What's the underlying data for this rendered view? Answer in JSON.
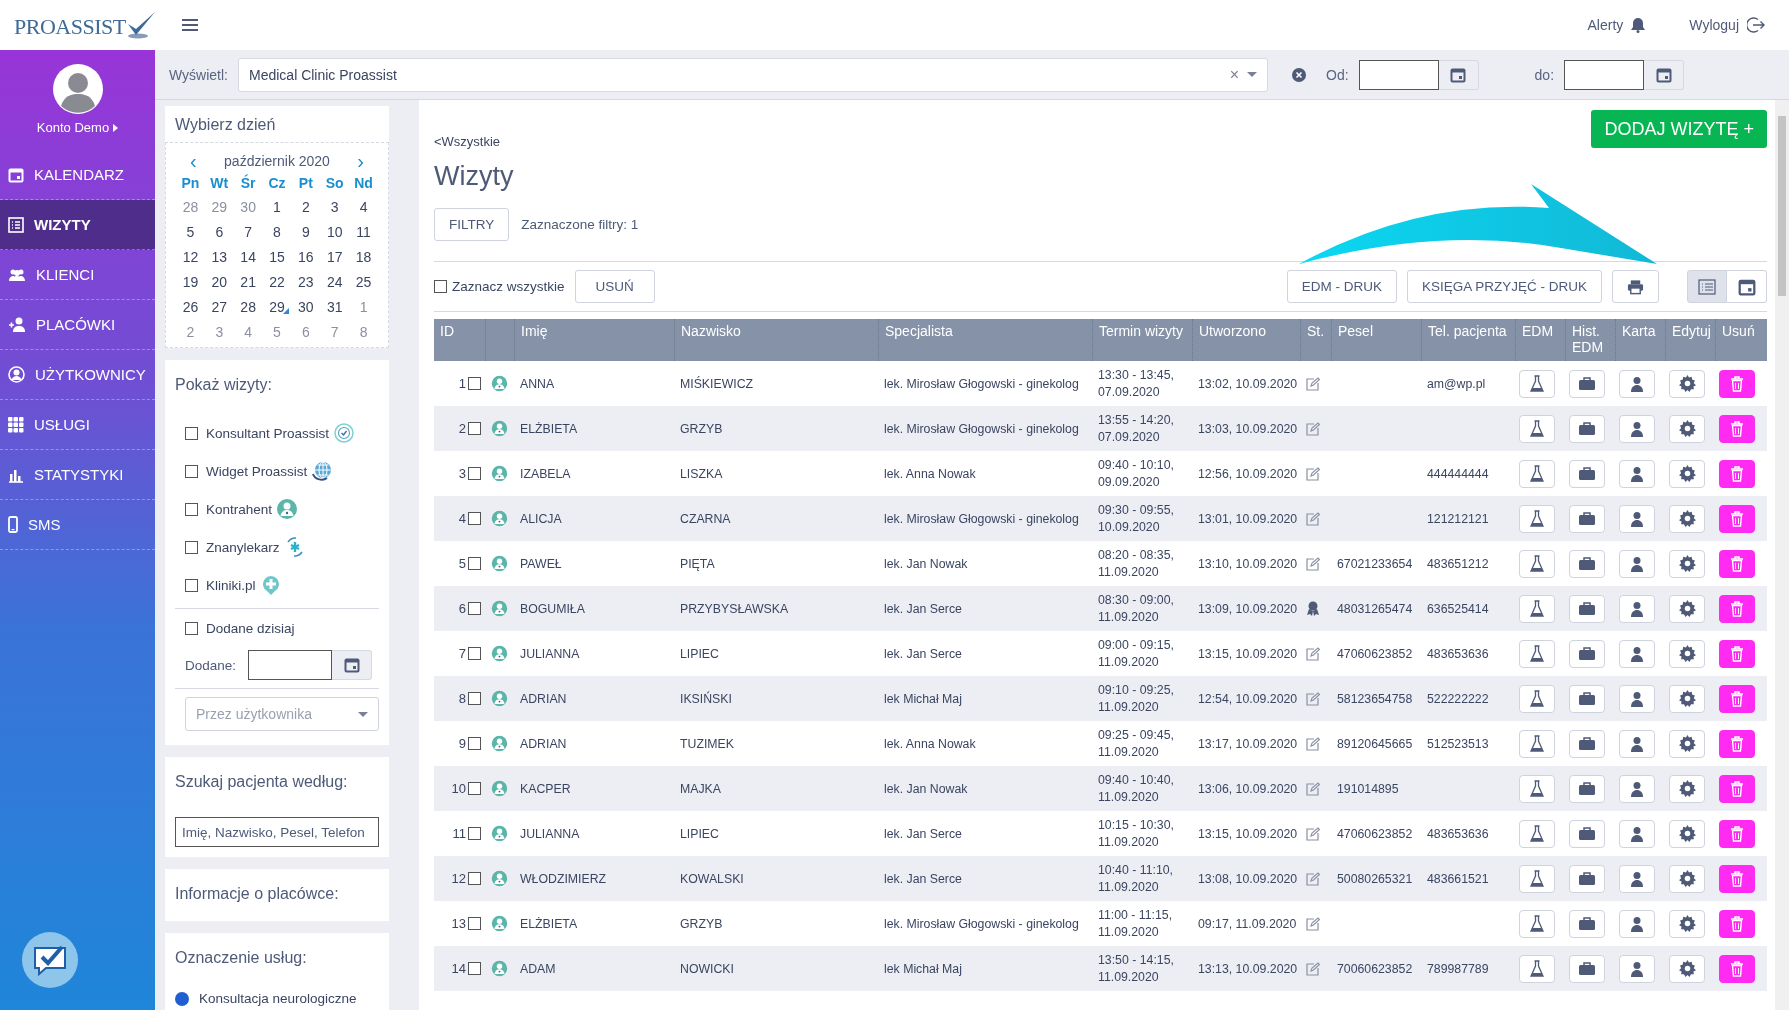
{
  "header": {
    "logo": "PROASSIST",
    "alerts": "Alerty",
    "logout": "Wyloguj"
  },
  "sidebar": {
    "user": "Konto Demo",
    "items": [
      {
        "label": "KALENDARZ",
        "kind": "calendar",
        "selected": false
      },
      {
        "label": "WIZYTY",
        "kind": "list",
        "selected": true
      },
      {
        "label": "KLIENCI",
        "kind": "group",
        "selected": false
      },
      {
        "label": "PLACÓWKI",
        "kind": "user-plus",
        "selected": false
      },
      {
        "label": "UŻYTKOWNICY",
        "kind": "user-circle",
        "selected": false
      },
      {
        "label": "USŁUGI",
        "kind": "grid",
        "selected": false
      },
      {
        "label": "STATYSTYKI",
        "kind": "bars",
        "selected": false
      },
      {
        "label": "SMS",
        "kind": "phone",
        "selected": false
      }
    ]
  },
  "filter_bar": {
    "display_label": "Wyświetl:",
    "display_value": "Medical Clinic Proassist",
    "clear": "×",
    "from_label": "Od:",
    "to_label": "do:"
  },
  "calendar": {
    "title": "Wybierz dzień",
    "month": "październik 2020",
    "prev": "‹",
    "next": "›",
    "weekdays": [
      "Pn",
      "Wt",
      "Śr",
      "Cz",
      "Pt",
      "So",
      "Nd"
    ],
    "weeks": [
      [
        {
          "day": "28",
          "muted": true,
          "marked": false
        },
        {
          "day": "29",
          "muted": true,
          "marked": false
        },
        {
          "day": "30",
          "muted": true,
          "marked": false
        },
        {
          "day": "1",
          "muted": false,
          "marked": false
        },
        {
          "day": "2",
          "muted": false,
          "marked": false
        },
        {
          "day": "3",
          "muted": false,
          "marked": false
        },
        {
          "day": "4",
          "muted": false,
          "marked": false
        }
      ],
      [
        {
          "day": "5",
          "muted": false,
          "marked": false
        },
        {
          "day": "6",
          "muted": false,
          "marked": false
        },
        {
          "day": "7",
          "muted": false,
          "marked": false
        },
        {
          "day": "8",
          "muted": false,
          "marked": false
        },
        {
          "day": "9",
          "muted": false,
          "marked": false
        },
        {
          "day": "10",
          "muted": false,
          "marked": false
        },
        {
          "day": "11",
          "muted": false,
          "marked": false
        }
      ],
      [
        {
          "day": "12",
          "muted": false,
          "marked": false
        },
        {
          "day": "13",
          "muted": false,
          "marked": false
        },
        {
          "day": "14",
          "muted": false,
          "marked": false
        },
        {
          "day": "15",
          "muted": false,
          "marked": false
        },
        {
          "day": "16",
          "muted": false,
          "marked": false
        },
        {
          "day": "17",
          "muted": false,
          "marked": false
        },
        {
          "day": "18",
          "muted": false,
          "marked": false
        }
      ],
      [
        {
          "day": "19",
          "muted": false,
          "marked": false
        },
        {
          "day": "20",
          "muted": false,
          "marked": false
        },
        {
          "day": "21",
          "muted": false,
          "marked": false
        },
        {
          "day": "22",
          "muted": false,
          "marked": false
        },
        {
          "day": "23",
          "muted": false,
          "marked": false
        },
        {
          "day": "24",
          "muted": false,
          "marked": false
        },
        {
          "day": "25",
          "muted": false,
          "marked": false
        }
      ],
      [
        {
          "day": "26",
          "muted": false,
          "marked": false
        },
        {
          "day": "27",
          "muted": false,
          "marked": false
        },
        {
          "day": "28",
          "muted": false,
          "marked": false
        },
        {
          "day": "29",
          "muted": false,
          "marked": true
        },
        {
          "day": "30",
          "muted": false,
          "marked": false
        },
        {
          "day": "31",
          "muted": false,
          "marked": false
        },
        {
          "day": "1",
          "muted": true,
          "marked": false
        }
      ],
      [
        {
          "day": "2",
          "muted": true,
          "marked": false
        },
        {
          "day": "3",
          "muted": true,
          "marked": false
        },
        {
          "day": "4",
          "muted": true,
          "marked": false
        },
        {
          "day": "5",
          "muted": true,
          "marked": false
        },
        {
          "day": "6",
          "muted": true,
          "marked": false
        },
        {
          "day": "7",
          "muted": true,
          "marked": false
        },
        {
          "day": "8",
          "muted": true,
          "marked": false
        }
      ]
    ]
  },
  "show_visits": {
    "title": "Pokaż wizyty:",
    "sources": [
      {
        "label": "Konsultant Proassist",
        "kind": "headset",
        "checked": false
      },
      {
        "label": "Widget Proassist",
        "kind": "globe",
        "checked": false
      },
      {
        "label": "Kontrahent",
        "kind": "person",
        "checked": false
      },
      {
        "label": "Znanylekarz",
        "kind": "medic",
        "checked": false
      },
      {
        "label": "Kliniki.pl",
        "kind": "cross",
        "checked": false
      }
    ],
    "added_today": {
      "label": "Dodane dzisiaj",
      "checked": false
    },
    "added_label": "Dodane:",
    "user_placeholder": "Przez użytkownika"
  },
  "search": {
    "title": "Szukaj pacjenta według:",
    "placeholder": "Imię, Nazwisko, Pesel, Telefon"
  },
  "clinic_info": {
    "title": "Informacje o placówce:"
  },
  "services": {
    "title": "Oznaczenie usług:",
    "items": [
      {
        "label": "Konsultacja neurologiczne",
        "color": "#1f5fd1"
      }
    ]
  },
  "main": {
    "back_link": "<Wszystkie",
    "title": "Wizyty",
    "add_button": "DODAJ WIZYTĘ +",
    "filters_button": "FILTRY",
    "filters_count": "Zaznaczone filtry: 1",
    "select_all": {
      "label": "Zaznacz wszystkie",
      "checked": false
    },
    "delete_button": "USUŃ",
    "edm_print": "EDM - DRUK",
    "book_print": "KSIĘGA PRZYJĘĆ - DRUK",
    "views": [
      {
        "kind": "list",
        "selected": true
      },
      {
        "kind": "calendar",
        "selected": false
      }
    ]
  },
  "table": {
    "columns": [
      "ID",
      "",
      "Imię",
      "Nazwisko",
      "Specjalista",
      "Termin wizyty",
      "Utworzono",
      "St.",
      "Pesel",
      "Tel. pacjenta",
      "EDM",
      "Hist. EDM",
      "Karta",
      "Edytuj",
      "Usuń"
    ],
    "rows": [
      {
        "id": "1",
        "checked": false,
        "first": "ANNA",
        "last": "MIŚKIEWICZ",
        "specialist": "lek. Mirosław Głogowski - ginekolog",
        "time": "13:30 - 13:45,",
        "date": "07.09.2020",
        "created": "13:02, 10.09.2020",
        "kind": "edit",
        "phone": "am@wp.pl"
      },
      {
        "id": "2",
        "checked": false,
        "first": "ELŻBIETA",
        "last": "GRZYB",
        "specialist": "lek. Mirosław Głogowski - ginekolog",
        "time": "13:55 - 14:20,",
        "date": "07.09.2020",
        "created": "13:03, 10.09.2020",
        "kind": "edit"
      },
      {
        "id": "3",
        "checked": false,
        "first": "IZABELA",
        "last": "LISZKA",
        "specialist": "lek. Anna Nowak",
        "time": "09:40 - 10:10,",
        "date": "09.09.2020",
        "created": "12:56, 10.09.2020",
        "kind": "edit",
        "phone": "444444444"
      },
      {
        "id": "4",
        "checked": false,
        "first": "ALICJA",
        "last": "CZARNA",
        "specialist": "lek. Mirosław Głogowski - ginekolog",
        "time": "09:30 - 09:55,",
        "date": "10.09.2020",
        "created": "13:01, 10.09.2020",
        "kind": "edit",
        "phone": "121212121"
      },
      {
        "id": "5",
        "checked": false,
        "first": "PAWEŁ",
        "last": "PIĘTA",
        "specialist": "lek. Jan Nowak",
        "time": "08:20 - 08:35,",
        "date": "11.09.2020",
        "created": "13:10, 10.09.2020",
        "kind": "edit",
        "pesel": "67021233654",
        "phone": "483651212"
      },
      {
        "id": "6",
        "checked": false,
        "first": "BOGUMIŁA",
        "last": "PRZYBYSŁAWSKA",
        "specialist": "lek. Jan Serce",
        "time": "08:30 - 09:00,",
        "date": "11.09.2020",
        "created": "13:09, 10.09.2020",
        "kind": "award",
        "pesel": "48031265474",
        "phone": "636525414"
      },
      {
        "id": "7",
        "checked": false,
        "first": "JULIANNA",
        "last": "LIPIEC",
        "specialist": "lek. Jan Serce",
        "time": "09:00 - 09:15,",
        "date": "11.09.2020",
        "created": "13:15, 10.09.2020",
        "kind": "edit",
        "pesel": "47060623852",
        "phone": "483653636"
      },
      {
        "id": "8",
        "checked": false,
        "first": "ADRIAN",
        "last": "IKSIŃSKI",
        "specialist": "lek Michał Maj",
        "time": "09:10 - 09:25,",
        "date": "11.09.2020",
        "created": "12:54, 10.09.2020",
        "kind": "edit",
        "pesel": "58123654758",
        "phone": "522222222"
      },
      {
        "id": "9",
        "checked": false,
        "first": "ADRIAN",
        "last": "TUZIMEK",
        "specialist": "lek. Anna Nowak",
        "time": "09:25 - 09:45,",
        "date": "11.09.2020",
        "created": "13:17, 10.09.2020",
        "kind": "edit",
        "pesel": "89120645665",
        "phone": "512523513"
      },
      {
        "id": "10",
        "checked": false,
        "first": "KACPER",
        "last": "MAJKA",
        "specialist": "lek. Jan Nowak",
        "time": "09:40 - 10:40,",
        "date": "11.09.2020",
        "created": "13:06, 10.09.2020",
        "kind": "edit",
        "pesel": "191014895"
      },
      {
        "id": "11",
        "checked": false,
        "first": "JULIANNA",
        "last": "LIPIEC",
        "specialist": "lek. Jan Serce",
        "time": "10:15 - 10:30,",
        "date": "11.09.2020",
        "created": "13:15, 10.09.2020",
        "kind": "edit",
        "pesel": "47060623852",
        "phone": "483653636"
      },
      {
        "id": "12",
        "checked": false,
        "first": "WŁODZIMIERZ",
        "last": "KOWALSKI",
        "specialist": "lek. Jan Serce",
        "time": "10:40 - 11:10,",
        "date": "11.09.2020",
        "created": "13:08, 10.09.2020",
        "kind": "edit",
        "pesel": "50080265321",
        "phone": "483661521"
      },
      {
        "id": "13",
        "checked": false,
        "first": "ELŻBIETA",
        "last": "GRZYB",
        "specialist": "lek. Mirosław Głogowski - ginekolog",
        "time": "11:00 - 11:15,",
        "date": "11.09.2020",
        "created": "09:17, 11.09.2020",
        "kind": "edit"
      },
      {
        "id": "14",
        "checked": false,
        "first": "ADAM",
        "last": "NOWICKI",
        "specialist": "lek Michał Maj",
        "time": "13:50 - 14:15,",
        "date": "11.09.2020",
        "created": "13:13, 10.09.2020",
        "kind": "edit",
        "pesel": "70060623852",
        "phone": "789987789"
      }
    ]
  }
}
